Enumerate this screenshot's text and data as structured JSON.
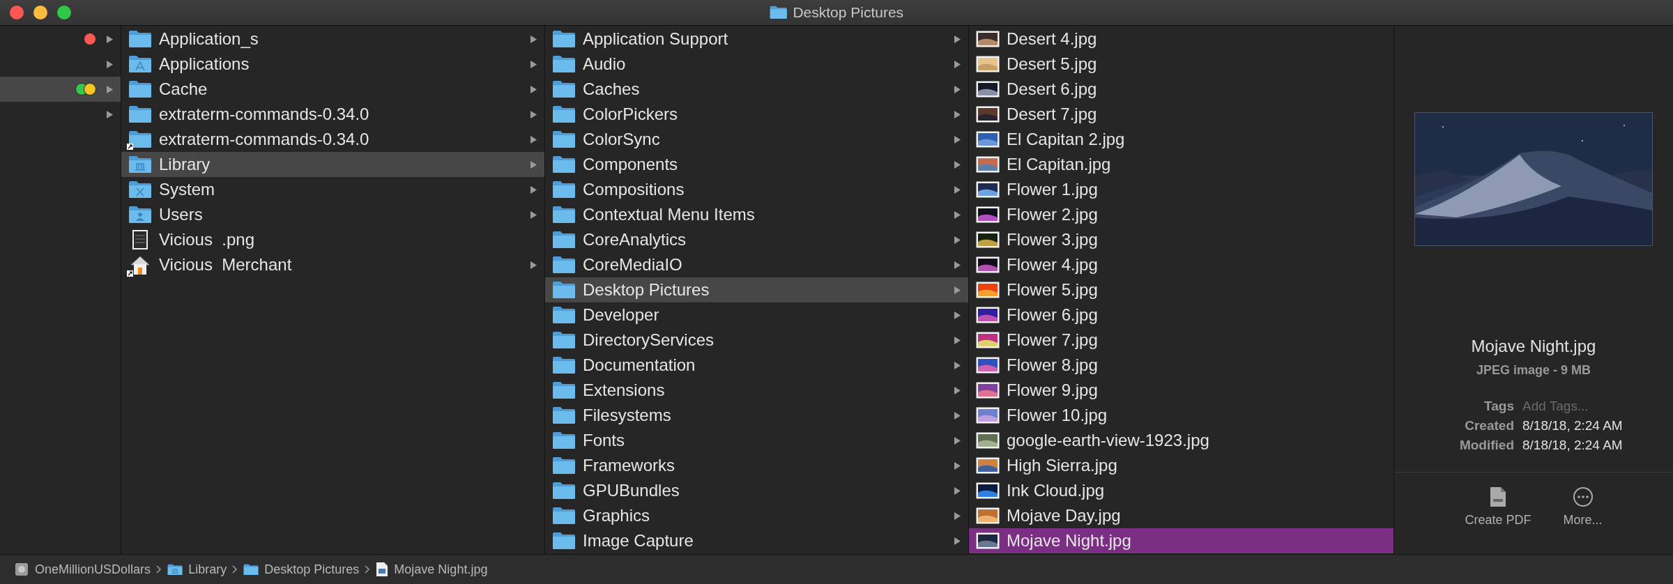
{
  "window": {
    "title": "Desktop Pictures"
  },
  "columns": [
    {
      "focused": false,
      "items": [
        {
          "selected": false,
          "expandable": true,
          "tags": [
            {
              "color": "#fc5753"
            }
          ]
        },
        {
          "selected": false,
          "expandable": true
        },
        {
          "selected": true,
          "expandable": true,
          "tags": [
            {
              "color": "#36c84a"
            },
            {
              "color": "#f5c524"
            }
          ]
        },
        {
          "selected": false,
          "expandable": true
        }
      ]
    },
    {
      "focused": false,
      "items": [
        {
          "label": "Application_s",
          "kind": "folder",
          "alias": false,
          "expandable": true,
          "selected": false
        },
        {
          "label": "Applications",
          "kind": "app-folder",
          "alias": false,
          "expandable": true,
          "selected": false
        },
        {
          "label": "Cache",
          "kind": "folder",
          "alias": false,
          "expandable": true,
          "selected": false
        },
        {
          "label": "extraterm-commands-0.34.0",
          "kind": "folder",
          "alias": false,
          "expandable": true,
          "selected": false
        },
        {
          "label": "extraterm-commands-0.34.0",
          "kind": "folder",
          "alias": true,
          "expandable": true,
          "selected": false
        },
        {
          "label": "Library",
          "kind": "library-folder",
          "alias": false,
          "expandable": true,
          "selected": true
        },
        {
          "label": "System",
          "kind": "system-folder",
          "alias": false,
          "expandable": true,
          "selected": false
        },
        {
          "label": "Users",
          "kind": "users-folder",
          "alias": false,
          "expandable": true,
          "selected": false
        },
        {
          "label": "Vicious  .png",
          "kind": "image-file",
          "alias": false,
          "expandable": false,
          "selected": false
        },
        {
          "label": "Vicious  Merchant",
          "kind": "home",
          "alias": true,
          "expandable": true,
          "selected": false
        }
      ]
    },
    {
      "focused": false,
      "items": [
        {
          "label": "Application Support",
          "kind": "folder",
          "alias": false,
          "expandable": true,
          "selected": false
        },
        {
          "label": "Audio",
          "kind": "folder",
          "alias": false,
          "expandable": true,
          "selected": false
        },
        {
          "label": "Caches",
          "kind": "folder",
          "alias": false,
          "expandable": true,
          "selected": false
        },
        {
          "label": "ColorPickers",
          "kind": "folder",
          "alias": false,
          "expandable": true,
          "selected": false
        },
        {
          "label": "ColorSync",
          "kind": "folder",
          "alias": false,
          "expandable": true,
          "selected": false
        },
        {
          "label": "Components",
          "kind": "folder",
          "alias": false,
          "expandable": true,
          "selected": false
        },
        {
          "label": "Compositions",
          "kind": "folder",
          "alias": false,
          "expandable": true,
          "selected": false
        },
        {
          "label": "Contextual Menu Items",
          "kind": "folder",
          "alias": false,
          "expandable": true,
          "selected": false
        },
        {
          "label": "CoreAnalytics",
          "kind": "folder",
          "alias": false,
          "expandable": true,
          "selected": false
        },
        {
          "label": "CoreMediaIO",
          "kind": "folder",
          "alias": false,
          "expandable": true,
          "selected": false
        },
        {
          "label": "Desktop Pictures",
          "kind": "folder",
          "alias": false,
          "expandable": true,
          "selected": true
        },
        {
          "label": "Developer",
          "kind": "folder",
          "alias": false,
          "expandable": true,
          "selected": false
        },
        {
          "label": "DirectoryServices",
          "kind": "folder",
          "alias": false,
          "expandable": true,
          "selected": false
        },
        {
          "label": "Documentation",
          "kind": "folder",
          "alias": false,
          "expandable": true,
          "selected": false
        },
        {
          "label": "Extensions",
          "kind": "folder",
          "alias": false,
          "expandable": true,
          "selected": false
        },
        {
          "label": "Filesystems",
          "kind": "folder",
          "alias": false,
          "expandable": true,
          "selected": false
        },
        {
          "label": "Fonts",
          "kind": "folder",
          "alias": false,
          "expandable": true,
          "selected": false
        },
        {
          "label": "Frameworks",
          "kind": "folder",
          "alias": false,
          "expandable": true,
          "selected": false
        },
        {
          "label": "GPUBundles",
          "kind": "folder",
          "alias": false,
          "expandable": true,
          "selected": false
        },
        {
          "label": "Graphics",
          "kind": "folder",
          "alias": false,
          "expandable": true,
          "selected": false
        },
        {
          "label": "Image Capture",
          "kind": "folder",
          "alias": false,
          "expandable": true,
          "selected": false
        }
      ]
    },
    {
      "focused": true,
      "items": [
        {
          "label": "Desert 4.jpg",
          "kind": "thumbnail",
          "alias": false,
          "expandable": false,
          "selected": false
        },
        {
          "label": "Desert 5.jpg",
          "kind": "thumbnail",
          "alias": false,
          "expandable": false,
          "selected": false
        },
        {
          "label": "Desert 6.jpg",
          "kind": "thumbnail",
          "alias": false,
          "expandable": false,
          "selected": false
        },
        {
          "label": "Desert 7.jpg",
          "kind": "thumbnail",
          "alias": false,
          "expandable": false,
          "selected": false
        },
        {
          "label": "El Capitan 2.jpg",
          "kind": "thumbnail",
          "alias": false,
          "expandable": false,
          "selected": false
        },
        {
          "label": "El Capitan.jpg",
          "kind": "thumbnail",
          "alias": false,
          "expandable": false,
          "selected": false
        },
        {
          "label": "Flower 1.jpg",
          "kind": "thumbnail",
          "alias": false,
          "expandable": false,
          "selected": false
        },
        {
          "label": "Flower 2.jpg",
          "kind": "thumbnail",
          "alias": false,
          "expandable": false,
          "selected": false
        },
        {
          "label": "Flower 3.jpg",
          "kind": "thumbnail",
          "alias": false,
          "expandable": false,
          "selected": false
        },
        {
          "label": "Flower 4.jpg",
          "kind": "thumbnail",
          "alias": false,
          "expandable": false,
          "selected": false
        },
        {
          "label": "Flower 5.jpg",
          "kind": "thumbnail",
          "alias": false,
          "expandable": false,
          "selected": false
        },
        {
          "label": "Flower 6.jpg",
          "kind": "thumbnail",
          "alias": false,
          "expandable": false,
          "selected": false
        },
        {
          "label": "Flower 7.jpg",
          "kind": "thumbnail",
          "alias": false,
          "expandable": false,
          "selected": false
        },
        {
          "label": "Flower 8.jpg",
          "kind": "thumbnail",
          "alias": false,
          "expandable": false,
          "selected": false
        },
        {
          "label": "Flower 9.jpg",
          "kind": "thumbnail",
          "alias": false,
          "expandable": false,
          "selected": false
        },
        {
          "label": "Flower 10.jpg",
          "kind": "thumbnail",
          "alias": false,
          "expandable": false,
          "selected": false
        },
        {
          "label": "google-earth-view-1923.jpg",
          "kind": "thumbnail",
          "alias": false,
          "expandable": false,
          "selected": false
        },
        {
          "label": "High Sierra.jpg",
          "kind": "thumbnail",
          "alias": false,
          "expandable": false,
          "selected": false
        },
        {
          "label": "Ink Cloud.jpg",
          "kind": "thumbnail",
          "alias": false,
          "expandable": false,
          "selected": false
        },
        {
          "label": "Mojave Day.jpg",
          "kind": "thumbnail",
          "alias": false,
          "expandable": false,
          "selected": false
        },
        {
          "label": "Mojave Night.jpg",
          "kind": "thumbnail",
          "alias": false,
          "expandable": false,
          "selected": true
        }
      ]
    }
  ],
  "preview": {
    "name": "Mojave Night.jpg",
    "kind": "JPEG image - 9 MB",
    "info": [
      {
        "label": "Tags",
        "placeholder": "Add Tags..."
      },
      {
        "label": "Created",
        "value": "8/18/18, 2:24 AM"
      },
      {
        "label": "Modified",
        "value": "8/18/18, 2:24 AM"
      }
    ],
    "actions": [
      {
        "label": "Create PDF",
        "kind": "pdf"
      },
      {
        "label": "More...",
        "kind": "more"
      }
    ]
  },
  "path_bar": [
    {
      "label": "OneMillionUSDollars",
      "kind": "disk"
    },
    {
      "label": "Library",
      "kind": "library-folder"
    },
    {
      "label": "Desktop Pictures",
      "kind": "folder"
    },
    {
      "label": "Mojave Night.jpg",
      "kind": "image-file"
    }
  ]
}
